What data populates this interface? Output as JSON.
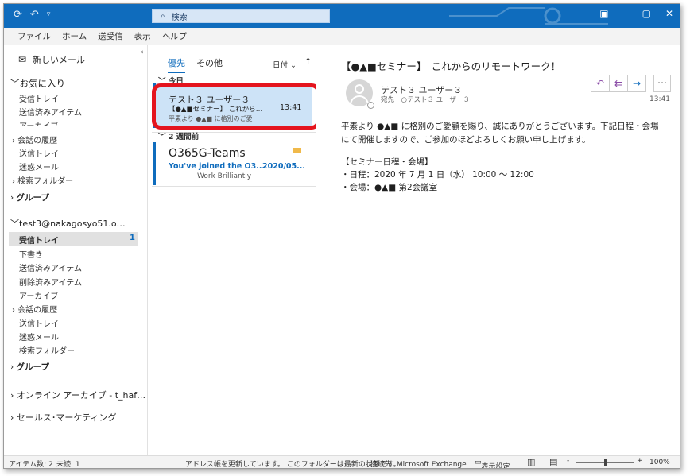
{
  "titlebar": {
    "search_placeholder": "検索"
  },
  "menu": [
    "ファイル",
    "ホーム",
    "送受信",
    "表示",
    "ヘルプ"
  ],
  "nav": {
    "new_mail": "新しいメール",
    "favorites": "お気に入り",
    "fav_items": [
      "受信トレイ",
      "送信済みアイテム",
      "アーカイブ",
      "会話の履歴",
      "送信トレイ",
      "迷惑メール",
      "検索フォルダー"
    ],
    "group1": "グループ",
    "account": "test3@nakagosyo51.o…",
    "acct_inbox": "受信トレイ",
    "acct_inbox_count": "1",
    "acct_items": [
      "下書き",
      "送信済みアイテム",
      "削除済みアイテム",
      "アーカイブ",
      "会話の履歴",
      "送信トレイ",
      "迷惑メール",
      "検索フォルダー"
    ],
    "group2": "グループ",
    "online_archive": "オンライン アーカイブ - t_haf…",
    "sales": "セールス･マーケティング"
  },
  "list": {
    "tab_focused": "優先",
    "tab_other": "その他",
    "sort": "日付",
    "group_today": "今日",
    "group_2weeks": "2 週間前",
    "mail1": {
      "from": "テスト３ ユーザー３",
      "subject": "【●▲■セミナー】 これから…",
      "time": "13:41",
      "preview": "平素より ●▲■ に格別のご愛"
    },
    "mail2": {
      "from": "O365G-Teams",
      "subject": "You've joined the O3...",
      "date": "2020/05...",
      "preview": "Work Brilliantly"
    }
  },
  "reading": {
    "subject": "【●▲■セミナー】　これからのリモートワーク！",
    "sender": "テスト３ ユーザー３",
    "to_label": "宛先",
    "to": "テスト３ ユーザー３",
    "time": "13:41",
    "body_line1": "平素より ●▲■ に格別のご愛顧を賜り、誠にありがとうございます。下記日程・会場",
    "body_line2": "にて開催しますので、ご参加のほどよろしくお願い申し上げます。",
    "section": "【セミナー日程・会場】",
    "date_line": "・日程：2020 年 7 月 1 日（水） 10:00 ～ 12:00",
    "venue_line": "・会場：●▲■ 第2会議室"
  },
  "status": {
    "items": "アイテム数: 2",
    "unread": "未読: 1",
    "message": "アドレス帳を更新しています。 このフォルダーは最新の状態です。",
    "connection": "接続先: Microsoft Exchange",
    "display": "表示設定",
    "zoom": "100%"
  }
}
